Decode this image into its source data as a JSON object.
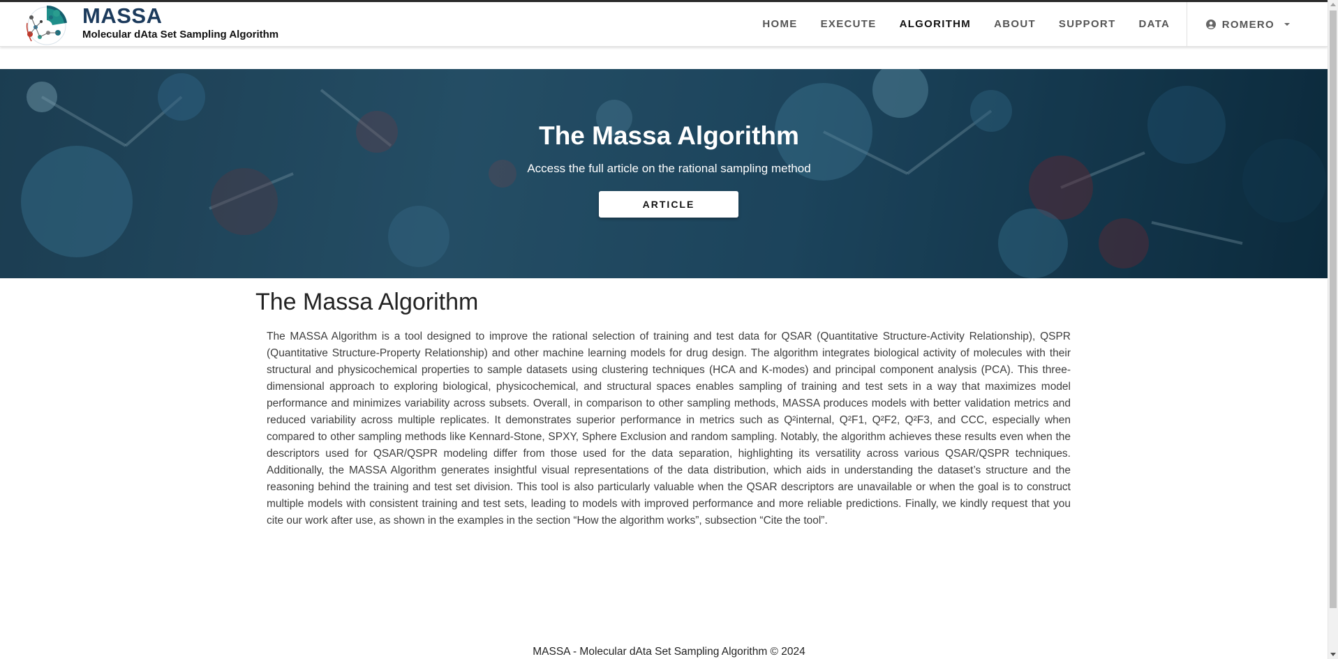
{
  "brand": {
    "title": "MASSA",
    "subtitle": "Molecular dAta Set Sampling Algorithm",
    "logo_icon": "molecule-logo-icon"
  },
  "nav": {
    "items": [
      {
        "label": "HOME",
        "active": false
      },
      {
        "label": "EXECUTE",
        "active": false
      },
      {
        "label": "ALGORITHM",
        "active": true
      },
      {
        "label": "ABOUT",
        "active": false
      },
      {
        "label": "SUPPORT",
        "active": false
      },
      {
        "label": "DATA",
        "active": false
      }
    ],
    "user": {
      "label": "ROMERO",
      "icon": "user-circle-icon",
      "menu_icon": "caret-down-icon"
    }
  },
  "hero": {
    "title": "The Massa Algorithm",
    "subtitle": "Access the full article on the rational sampling method",
    "button_label": "ARTICLE"
  },
  "content": {
    "title": "The Massa Algorithm",
    "paragraph": "The MASSA Algorithm is a tool designed to improve the rational selection of training and test data for QSAR (Quantitative Structure-Activity Relationship), QSPR (Quantitative Structure-Property Relationship) and other machine learning models for drug design. The algorithm integrates biological activity of molecules with their structural and physicochemical properties to sample datasets using clustering techniques (HCA and K-modes) and principal component analysis (PCA). This three-dimensional approach to exploring biological, physicochemical, and structural spaces enables sampling of training and test sets in a way that maximizes model performance and minimizes variability across subsets. Overall, in comparison to other sampling methods, MASSA produces models with better validation metrics and reduced variability across multiple replicates. It demonstrates superior performance in metrics such as Q²internal, Q²F1, Q²F2, Q²F3, and CCC, especially when compared to other sampling methods like Kennard-Stone, SPXY, Sphere Exclusion and random sampling. Notably, the algorithm achieves these results even when the descriptors used for QSAR/QSPR modeling differ from those used for the data separation, highlighting its versatility across various QSAR/QSPR techniques. Additionally, the MASSA Algorithm generates insightful visual representations of the data distribution, which aids in understanding the dataset’s structure and the reasoning behind the training and test set division. This tool is also particularly valuable when the QSAR descriptors are unavailable or when the goal is to construct multiple models with consistent training and test sets, leading to models with improved performance and more reliable predictions. Finally, we kindly request that you cite our work after use, as shown in the examples in the section “How the algorithm works”, subsection “Cite the tool”."
  },
  "footer": {
    "text": "MASSA - Molecular dAta Set Sampling Algorithm © 2024"
  },
  "colors": {
    "brand": "#1b3a5c",
    "hero_dark": "#0d2e42",
    "hero_mid": "#2e5d78"
  }
}
